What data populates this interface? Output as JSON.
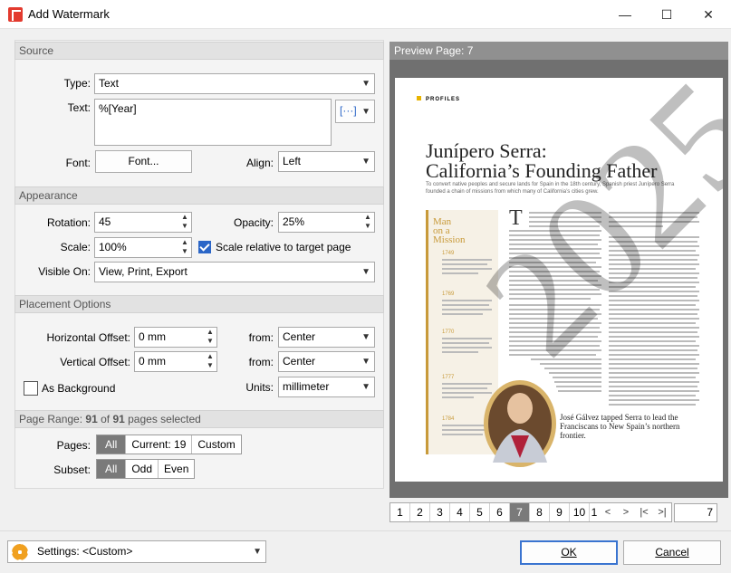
{
  "window": {
    "title": "Add Watermark",
    "minimize": "—",
    "maximize": "☐",
    "close": "✕"
  },
  "source": {
    "heading": "Source",
    "type_label": "Type:",
    "type_value": "Text",
    "text_label": "Text:",
    "text_value": "%[Year]",
    "macro_button": "[···]",
    "font_label": "Font:",
    "font_button": "Font...",
    "align_label": "Align:",
    "align_value": "Left"
  },
  "appearance": {
    "heading": "Appearance",
    "rotation_label": "Rotation:",
    "rotation_value": "45",
    "opacity_label": "Opacity:",
    "opacity_value": "25%",
    "scale_label": "Scale:",
    "scale_value": "100%",
    "scale_relative_label": "Scale relative to target page",
    "scale_relative_checked": true,
    "visible_on_label": "Visible On:",
    "visible_on_value": "View, Print, Export"
  },
  "placement": {
    "heading": "Placement Options",
    "h_offset_label": "Horizontal Offset:",
    "h_offset_value": "0 mm",
    "h_from_label": "from:",
    "h_from_value": "Center",
    "v_offset_label": "Vertical Offset:",
    "v_offset_value": "0 mm",
    "v_from_label": "from:",
    "v_from_value": "Center",
    "as_background_label": "As Background",
    "as_background_checked": false,
    "units_label": "Units:",
    "units_value": "millimeter"
  },
  "page_range": {
    "heading_prefix": "Page Range: ",
    "selected": "91",
    "of_text": " of ",
    "total": "91",
    "suffix": " pages selected",
    "pages_label": "Pages:",
    "pages_options": [
      "All",
      "Current: 19",
      "Custom"
    ],
    "subset_label": "Subset:",
    "subset_options": [
      "All",
      "Odd",
      "Even"
    ]
  },
  "preview": {
    "heading": "Preview Page: 7",
    "page_numbers": [
      "1",
      "2",
      "3",
      "4",
      "5",
      "6",
      "7",
      "8",
      "9",
      "10",
      "1"
    ],
    "active_page": "7",
    "current_page_input": "7",
    "document": {
      "section_tag": "PROFILES",
      "headline_1": "Junípero Serra:",
      "headline_2": "California’s Founding Father",
      "dek": "To convert native peoples and secure lands for Spain in the 18th century, Spanish priest Junípero Serra founded a chain of missions from which many of California’s cities grew.",
      "sidebar_title_1": "Man",
      "sidebar_title_2": "on a",
      "sidebar_title_3": "Mission",
      "years": [
        "1749",
        "1769",
        "1770",
        "1777",
        "1784"
      ],
      "caption": "José Gálvez tapped Serra to lead the Franciscans to New Spain’s northern frontier.",
      "watermark_text": "2025"
    }
  },
  "footer": {
    "settings_label": "Settings:",
    "settings_value": "<Custom>",
    "ok": "OK",
    "cancel": "Cancel"
  },
  "colors": {
    "accent": "#2b66c7",
    "section_tag": "#e8b400",
    "sidebar_title": "#c89a3a"
  }
}
